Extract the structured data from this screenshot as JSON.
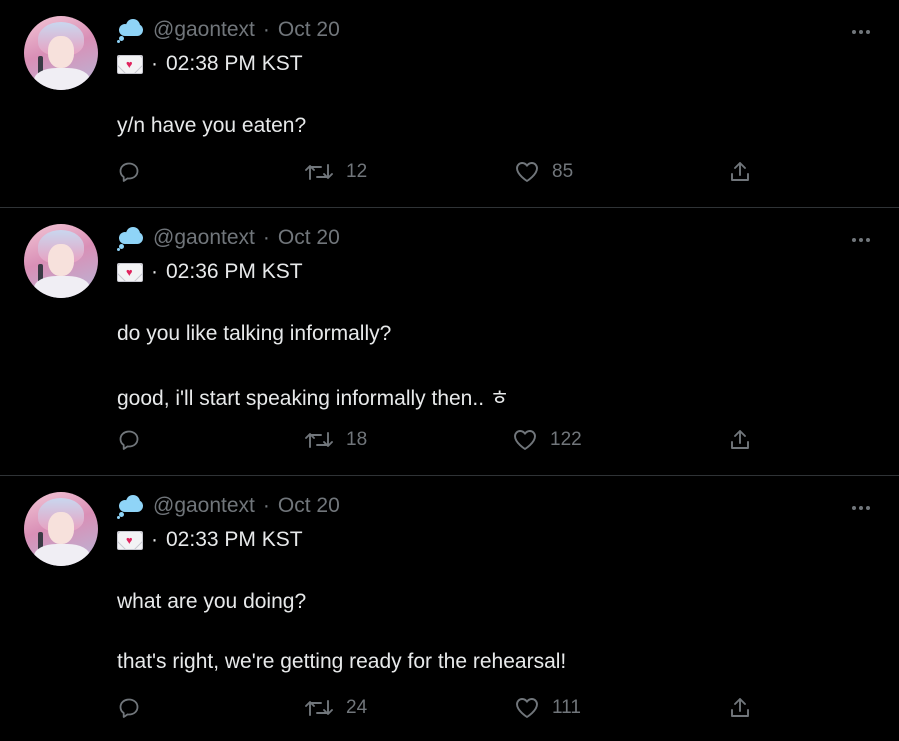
{
  "tweets": [
    {
      "handle": "@gaontext",
      "date": "Oct 20",
      "time": "02:38 PM KST",
      "lines": [
        "y/n have you eaten?"
      ],
      "retweets": "12",
      "likes": "85"
    },
    {
      "handle": "@gaontext",
      "date": "Oct 20",
      "time": "02:36 PM KST",
      "lines": [
        "do you like talking informally?",
        "good, i'll start speaking informally then.. ㅎ"
      ],
      "retweets": "18",
      "likes": "122"
    },
    {
      "handle": "@gaontext",
      "date": "Oct 20",
      "time": "02:33 PM KST",
      "lines": [
        "what are you doing?",
        "that's right, we're getting ready for the rehearsal!"
      ],
      "retweets": "24",
      "likes": "111"
    }
  ],
  "separator": "·",
  "icons": {
    "header_emoji": "thought-cloud-icon",
    "time_emoji": "love-letter-icon",
    "more": "more-icon",
    "reply": "reply-icon",
    "retweet": "retweet-icon",
    "like": "heart-icon",
    "share": "share-icon"
  },
  "colors": {
    "background": "#000000",
    "text_primary": "#e7e9ea",
    "text_secondary": "#71767b",
    "divider": "#2f3336"
  }
}
